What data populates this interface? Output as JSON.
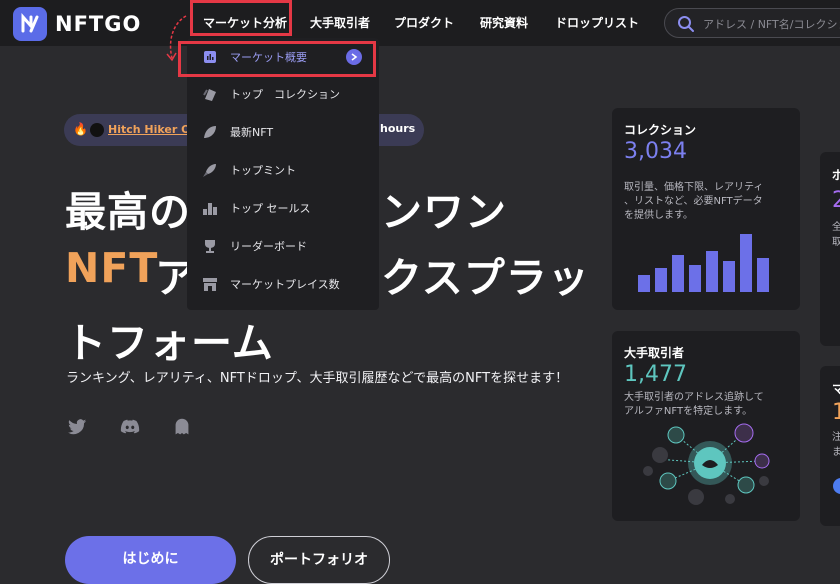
{
  "brand": {
    "name": "NFTGO",
    "logo_letter": "N"
  },
  "nav": [
    {
      "label": "マーケット分析",
      "active": true
    },
    {
      "label": "大手取引者"
    },
    {
      "label": "プロダクト"
    },
    {
      "label": "研究資料"
    },
    {
      "label": "ドロップリスト"
    }
  ],
  "search": {
    "placeholder": "アドレス / NFT名/コレクション"
  },
  "dropdown": [
    {
      "label": "マーケット概要",
      "icon": "bar-chart-icon",
      "highlighted": true
    },
    {
      "label": "トップ　コレクション",
      "icon": "cards-icon"
    },
    {
      "label": "最新NFT",
      "icon": "leaf-icon"
    },
    {
      "label": "トップミント",
      "icon": "rocket-icon"
    },
    {
      "label": "トップ セールス",
      "icon": "bars-icon"
    },
    {
      "label": "リーダーボード",
      "icon": "trophy-icon"
    },
    {
      "label": "マーケットプレイス数",
      "icon": "store-icon"
    }
  ],
  "ticker": {
    "name": "Hitch Hiker Of...",
    "hours": "hours"
  },
  "hero": {
    "line1_a": "最高の",
    "line1_b": "ンワン",
    "line2_a": "NFT",
    "line2_b": "ア",
    "line2_c": "クスプラッ",
    "line3": "トフォーム",
    "sub": "ランキング、レアリティ、NFTドロップ、大手取引履歴などで最高のNFTを探せます！"
  },
  "buttons": {
    "start": "はじめに",
    "portfolio": "ポートフォリオ"
  },
  "cards": {
    "collection": {
      "title": "コレクション",
      "count": "3,034",
      "desc1": "取引量、価格下限、レアリティ",
      "desc2": "、リストなど、必要NFTデータ",
      "desc3": "を提供します。",
      "bars": [
        0.25,
        0.35,
        0.55,
        0.4,
        0.6,
        0.45,
        0.85,
        0.5
      ]
    },
    "whales": {
      "title": "大手取引者",
      "count": "1,477",
      "desc1": "大手取引者のアドレス追跡して",
      "desc2": "アルファNFTを特定します。"
    },
    "right_partial": {
      "t1": "ポ",
      "n1": "2",
      "d1": "全",
      "d2": "取",
      "t2": "マ",
      "n2": "1",
      "d3": "注",
      "d4": "ま"
    }
  },
  "colors": {
    "accent": "#6c70e8",
    "orange": "#f0a25a",
    "highlight": "#e53845",
    "teal": "#5ec6bf",
    "purple": "#a56cf0"
  }
}
